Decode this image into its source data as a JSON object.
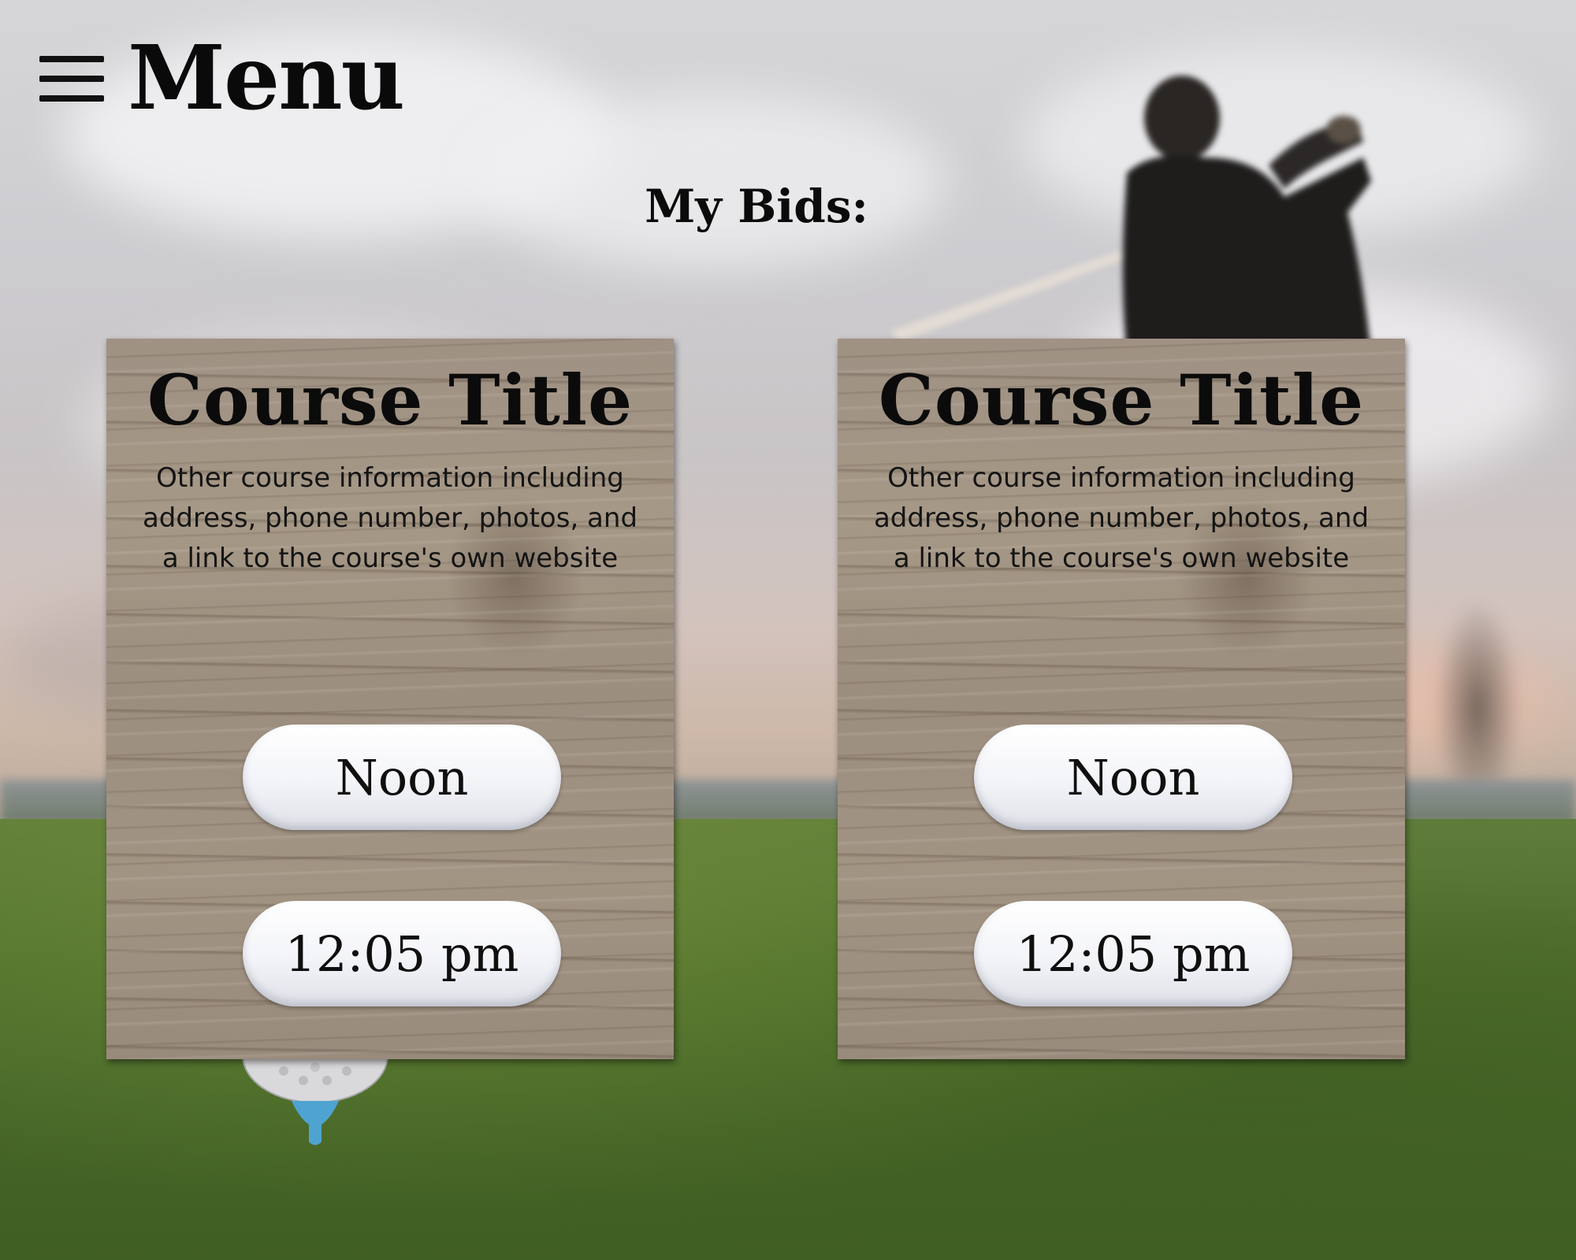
{
  "header": {
    "menu_label": "Menu",
    "menu_icon": "hamburger-icon"
  },
  "page_title": "My Bids:",
  "cards": [
    {
      "title": "Course Title",
      "info": "Other course information including address, phone number, photos, and a link to the course's own website",
      "slot_label": "Noon",
      "time_label": "12:05 pm"
    },
    {
      "title": "Course Title",
      "info": "Other course information including address, phone number, photos, and a link to the course's own website",
      "slot_label": "Noon",
      "time_label": "12:05 pm"
    }
  ],
  "colors": {
    "text": "#0b0b0b",
    "pill": "#f3f4f8",
    "tee": "#4fa3d1"
  }
}
